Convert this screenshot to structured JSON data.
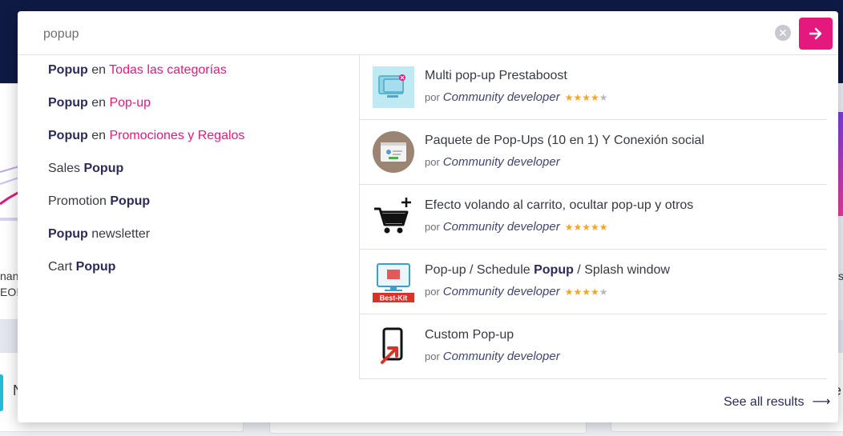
{
  "background": {
    "left_text_1": "nan",
    "left_text_2": "EO!",
    "left_letter": "N",
    "right_text_1": "s",
    "right_letter": "le"
  },
  "search": {
    "value": "popup",
    "placeholder": ""
  },
  "suggestions": [
    {
      "bold": "Popup",
      "mid": " en ",
      "category": "Todas las categorías"
    },
    {
      "bold": "Popup",
      "mid": " en ",
      "category": "Pop-up"
    },
    {
      "bold": "Popup",
      "mid": " en ",
      "category": "Promociones y Regalos"
    },
    {
      "pre": "Sales ",
      "bold": "Popup"
    },
    {
      "pre": "Promotion ",
      "bold": "Popup"
    },
    {
      "bold": "Popup",
      "post": " newsletter"
    },
    {
      "pre": "Cart ",
      "bold": "Popup"
    }
  ],
  "results": [
    {
      "title": "Multi pop-up Prestaboost",
      "by": "por",
      "author": "Community developer",
      "rating": 4,
      "icon": "monitor-popup-icon"
    },
    {
      "title": "Paquete de Pop-Ups (10 en 1) Y Conexión social",
      "by": "por",
      "author": "Community developer",
      "rating": 0,
      "icon": "browser-profile-icon"
    },
    {
      "title": "Efecto volando al carrito, ocultar pop-up y otros",
      "by": "por",
      "author": "Community developer",
      "rating": 5,
      "icon": "cart-plus-icon"
    },
    {
      "title_pre": "Pop-up / Schedule ",
      "title_bold": "Popup",
      "title_post": " / Splash window",
      "by": "por",
      "author": "Community developer",
      "rating": 4,
      "icon": "best-kit-monitor-icon",
      "badge": "Best-Kit"
    },
    {
      "title": "Custom Pop-up",
      "by": "por",
      "author": "Community developer",
      "rating": 0,
      "icon": "phone-arrow-icon"
    }
  ],
  "see_all": "See all results",
  "colors": {
    "accent": "#e4197d",
    "header_bg": "#0f1a44",
    "star": "#f5a623"
  }
}
